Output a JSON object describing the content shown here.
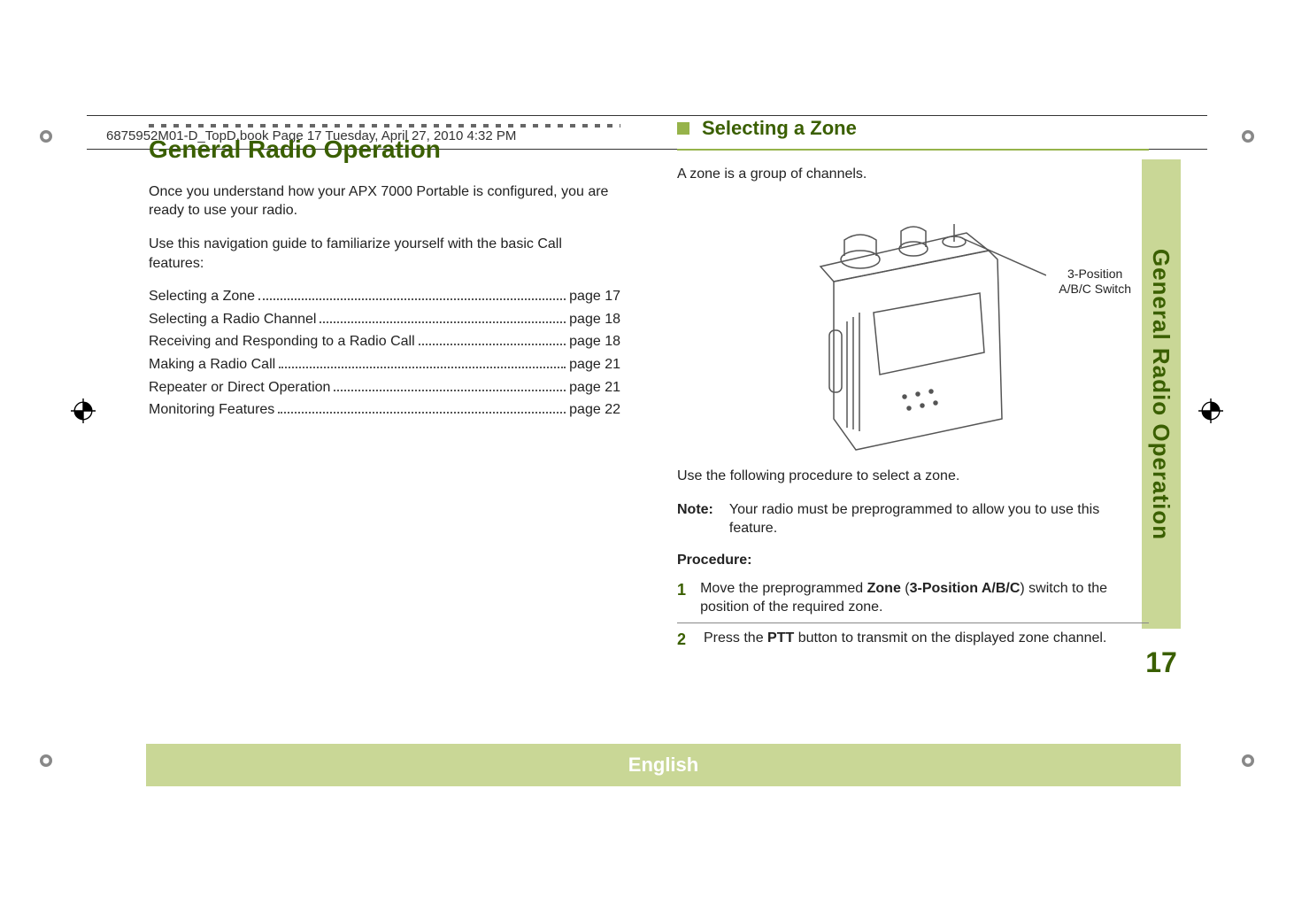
{
  "framemaker_header": "6875952M01-D_TopD.book  Page 17  Tuesday, April 27, 2010  4:32 PM",
  "side_tab": "General Radio Operation",
  "page_number": "17",
  "language_bar": "English",
  "left": {
    "title": "General Radio Operation",
    "intro1": "Once you understand how your APX 7000 Portable is configured, you are ready to use your radio.",
    "intro2": "Use this navigation guide to familiarize yourself with the basic Call features:",
    "toc": [
      {
        "label": "Selecting a Zone",
        "page": "page 17"
      },
      {
        "label": "Selecting a Radio Channel",
        "page": "page 18"
      },
      {
        "label": "Receiving and Responding to a Radio Call",
        "page": "page 18"
      },
      {
        "label": "Making a Radio Call",
        "page": "page 21"
      },
      {
        "label": "Repeater or Direct Operation",
        "page": "page 21"
      },
      {
        "label": "Monitoring Features",
        "page": "page 22"
      }
    ]
  },
  "right": {
    "heading": "Selecting a Zone",
    "zone_intro": "A zone is a group of channels.",
    "callout_line1": "3-Position",
    "callout_line2": "A/B/C Switch",
    "use_procedure": "Use the following procedure to select a zone.",
    "note_label": "Note:",
    "note_text": "Your radio must be preprogrammed to allow you to use this feature.",
    "procedure_label": "Procedure:",
    "steps": [
      {
        "num": "1",
        "pre": "Move the preprogrammed ",
        "b1": "Zone",
        "mid": " (",
        "b2": "3-Position A/B/C",
        "post": ") switch to the position of the required zone."
      },
      {
        "num": "2",
        "pre": "Press the ",
        "b1": "PTT",
        "mid": "",
        "b2": "",
        "post": " button to transmit on the displayed zone channel."
      }
    ]
  }
}
